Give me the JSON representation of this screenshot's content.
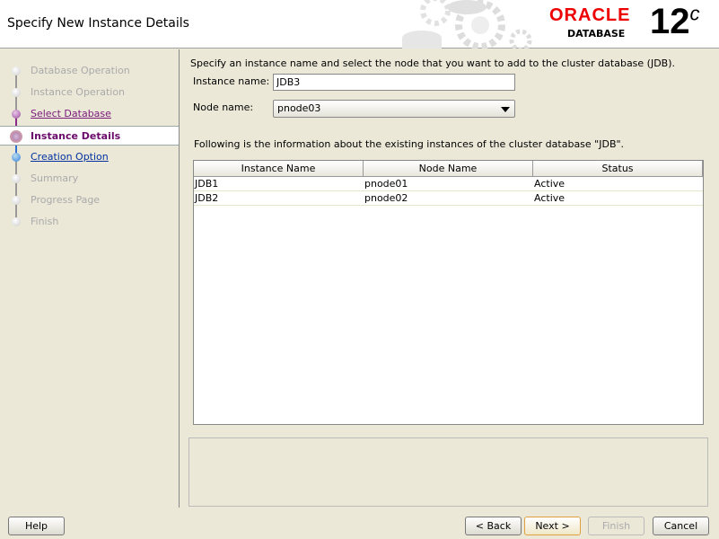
{
  "header": {
    "title": "Specify New Instance Details",
    "brand": "ORACLE",
    "product": "DATABASE",
    "version": "12",
    "version_suffix": "c"
  },
  "steps": [
    {
      "label": "Database Operation",
      "state": "inactive"
    },
    {
      "label": "Instance Operation",
      "state": "inactive"
    },
    {
      "label": "Select Database",
      "state": "done"
    },
    {
      "label": "Instance Details",
      "state": "current"
    },
    {
      "label": "Creation Option",
      "state": "next"
    },
    {
      "label": "Summary",
      "state": "inactive"
    },
    {
      "label": "Progress Page",
      "state": "inactive"
    },
    {
      "label": "Finish",
      "state": "inactive"
    }
  ],
  "main": {
    "intro": "Specify an instance name and select the node that you want to add to the cluster database (JDB).",
    "instance_label": "Instance name:",
    "instance_value": "JDB3",
    "node_label": "Node name:",
    "node_value": "pnode03",
    "info": "Following is the information about the existing instances of the cluster database \"JDB\".",
    "columns": [
      "Instance Name",
      "Node Name",
      "Status"
    ],
    "rows": [
      [
        "JDB1",
        "pnode01",
        "Active"
      ],
      [
        "JDB2",
        "pnode02",
        "Active"
      ]
    ]
  },
  "buttons": {
    "help": "Help",
    "back": "< Back",
    "next": "Next >",
    "finish": "Finish",
    "cancel": "Cancel"
  }
}
